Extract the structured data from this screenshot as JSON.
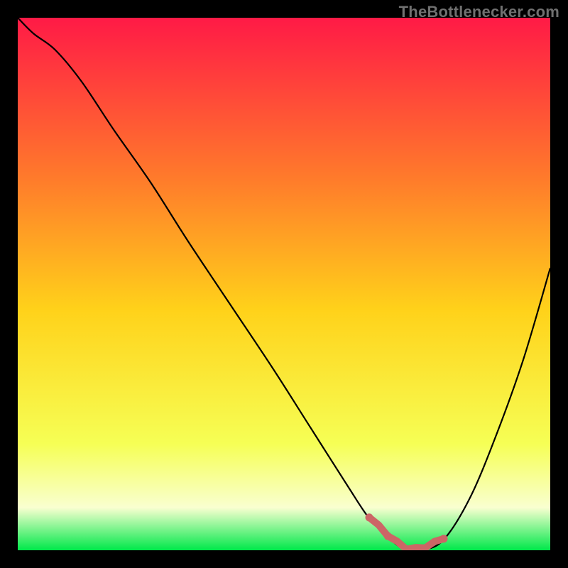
{
  "watermark": "TheBottlenecker.com",
  "colors": {
    "background": "#000000",
    "gradient_top": "#ff1a46",
    "gradient_mid_upper": "#ff7a2b",
    "gradient_mid": "#ffd21a",
    "gradient_lower": "#f6ff55",
    "gradient_pale": "#f9ffd0",
    "gradient_bottom": "#00e84a",
    "curve": "#000000",
    "marker": "#cc6666"
  },
  "chart_data": {
    "type": "line",
    "title": "",
    "xlabel": "",
    "ylabel": "",
    "xlim": [
      0,
      100
    ],
    "ylim": [
      0,
      100
    ],
    "grid": false,
    "legend": false,
    "x": [
      0,
      3,
      7,
      12,
      18,
      25,
      32,
      40,
      48,
      55,
      62,
      66,
      70,
      73,
      76,
      80,
      85,
      90,
      95,
      100
    ],
    "values": [
      100,
      97,
      94,
      88,
      79,
      69,
      58,
      46,
      34,
      23,
      12,
      6,
      2,
      0,
      0,
      2,
      10,
      22,
      36,
      53
    ],
    "marker_region": {
      "x_start": 66,
      "x_end": 80,
      "band_value": 0
    },
    "gradient_stops": [
      {
        "offset": 0,
        "value": 100,
        "color": "#ff1a46"
      },
      {
        "offset": 30,
        "value": 70,
        "color": "#ff7a2b"
      },
      {
        "offset": 55,
        "value": 45,
        "color": "#ffd21a"
      },
      {
        "offset": 80,
        "value": 20,
        "color": "#f6ff55"
      },
      {
        "offset": 92,
        "value": 8,
        "color": "#f9ffd0"
      },
      {
        "offset": 100,
        "value": 0,
        "color": "#00e84a"
      }
    ]
  }
}
